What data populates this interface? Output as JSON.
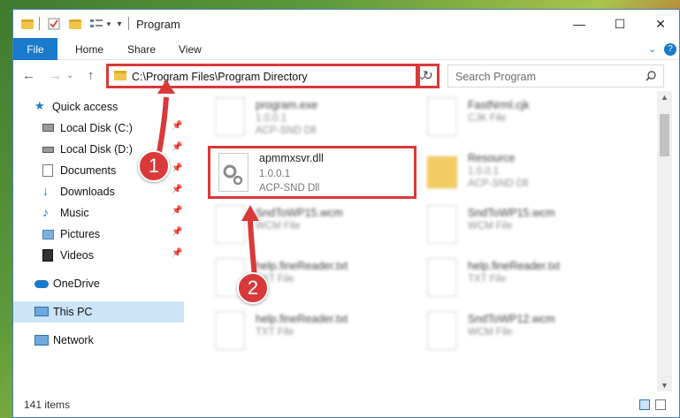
{
  "window": {
    "title": "Program",
    "minimize": "—",
    "maximize": "☐",
    "close": "✕"
  },
  "ribbon": {
    "tabs": [
      "File",
      "Home",
      "Share",
      "View"
    ],
    "help": "?"
  },
  "nav": {
    "back": "←",
    "forward": "→",
    "up": "↑",
    "address": "C:\\Program Files\\Program Directory",
    "dropdown": "⌄",
    "refresh": "↻"
  },
  "search": {
    "placeholder": "Search Program"
  },
  "sidebar": {
    "items": [
      {
        "label": "Quick access",
        "icon": "star-icon"
      },
      {
        "label": "Local Disk (C:)",
        "icon": "drive-icon",
        "pinned": true
      },
      {
        "label": "Local Disk (D:)",
        "icon": "drive-icon",
        "pinned": true
      },
      {
        "label": "Documents",
        "icon": "documents-icon",
        "pinned": true
      },
      {
        "label": "Downloads",
        "icon": "download-icon",
        "pinned": true
      },
      {
        "label": "Music",
        "icon": "music-icon",
        "pinned": true
      },
      {
        "label": "Pictures",
        "icon": "pictures-icon",
        "pinned": true
      },
      {
        "label": "Videos",
        "icon": "videos-icon",
        "pinned": true
      },
      {
        "label": "OneDrive",
        "icon": "cloud-icon"
      },
      {
        "label": "This PC",
        "icon": "pc-icon",
        "selected": true
      },
      {
        "label": "Network",
        "icon": "network-icon"
      }
    ]
  },
  "files": [
    {
      "name": "program.exe",
      "l2": "1.0.0.1",
      "l3": "ACP-SND Dll"
    },
    {
      "name": "FastNrml.cjk",
      "l2": "CJK File",
      "l3": ""
    },
    {
      "name": "apmmxsvr.dll",
      "l2": "1.0.0.1",
      "l3": "ACP-SND Dll"
    },
    {
      "name": "Resource",
      "l2": "1.0.0.1",
      "l3": "ACP-SND Dll"
    },
    {
      "name": "SndToWP15.wcm",
      "l2": "WCM File",
      "l3": ""
    },
    {
      "name": "SndToWP15.wcm",
      "l2": "WCM File",
      "l3": ""
    },
    {
      "name": "help.fineReader.txt",
      "l2": "TXT File",
      "l3": ""
    },
    {
      "name": "help.fineReader.txt",
      "l2": "TXT File",
      "l3": ""
    },
    {
      "name": "help.fineReader.txt",
      "l2": "TXT File",
      "l3": ""
    },
    {
      "name": "SndToWP12.wcm",
      "l2": "WCM File",
      "l3": ""
    }
  ],
  "annotations": {
    "step1": "1",
    "step2": "2"
  },
  "status": {
    "count": "141 items"
  },
  "colors": {
    "accent": "#1979ca",
    "highlight": "#d9393a",
    "selected": "#cce4f7"
  }
}
